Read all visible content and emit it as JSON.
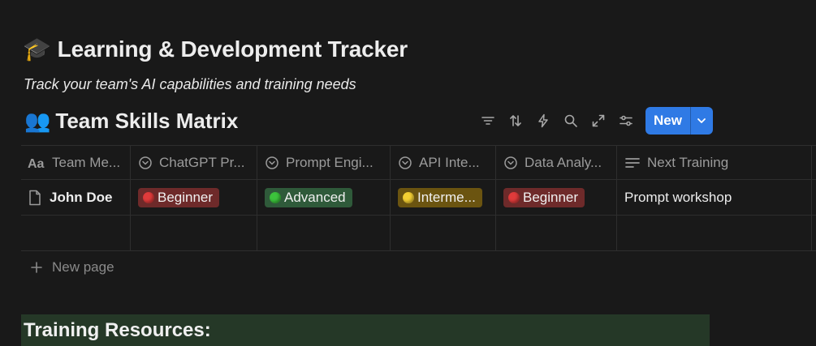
{
  "page": {
    "icon": "🎓",
    "title": "Learning & Development Tracker",
    "subtitle": "Track your team's AI capabilities and training needs"
  },
  "database": {
    "icon": "👥",
    "title": "Team Skills Matrix",
    "toolbar": {
      "icons": [
        "filter-icon",
        "sort-icon",
        "automation-lightning-icon",
        "search-icon",
        "expand-icon",
        "settings-sliders-icon"
      ],
      "new_label": "New",
      "accent_color": "#2f7ae5"
    },
    "columns": [
      {
        "label": "Team Me...",
        "icon": "title-aa-icon"
      },
      {
        "label": "ChatGPT Pr...",
        "icon": "select-icon"
      },
      {
        "label": "Prompt Engi...",
        "icon": "select-icon"
      },
      {
        "label": "API Inte...",
        "icon": "select-icon"
      },
      {
        "label": "Data Analy...",
        "icon": "select-icon"
      },
      {
        "label": "Next Training",
        "icon": "text-lines-icon"
      }
    ],
    "rows": [
      {
        "name": "John Doe",
        "chatgpt": {
          "label": "Beginner",
          "color": "#6e2a2a",
          "dot": "#e03b3b"
        },
        "prompt": {
          "label": "Advanced",
          "color": "#2f5a3a",
          "dot": "#3cc43c"
        },
        "api": {
          "label": "Interme...",
          "color": "#6b5410",
          "dot": "#f5d033"
        },
        "data": {
          "label": "Beginner",
          "color": "#6e2a2a",
          "dot": "#e03b3b"
        },
        "next_training": "Prompt workshop"
      }
    ],
    "new_page_label": "New page"
  },
  "callout": {
    "text": "Training Resources:",
    "background": "#253827"
  }
}
